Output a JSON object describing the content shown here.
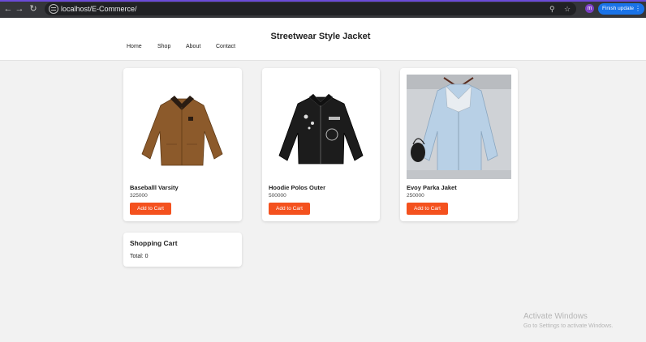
{
  "browser": {
    "url": "localhost/E-Commerce/",
    "profile_initial": "m",
    "finish_update_label": "Finish update",
    "back_icon": "arrow-left-icon",
    "forward_icon": "arrow-right-icon",
    "reload_icon": "reload-icon",
    "accent_color": "#6b4bd8"
  },
  "header": {
    "title": "Streetwear Style Jacket",
    "nav": [
      "Home",
      "Shop",
      "About",
      "Contact"
    ]
  },
  "products": [
    {
      "name": "Baseballl Varsity",
      "price": "325000",
      "button": "Add to Cart"
    },
    {
      "name": "Hoodie Polos Outer",
      "price": "500000",
      "button": "Add to Cart"
    },
    {
      "name": "Evoy Parka Jaket",
      "price": "250000",
      "button": "Add to Cart"
    }
  ],
  "cart": {
    "title": "Shopping Cart",
    "total_label": "Total: 0"
  },
  "watermark": {
    "title": "Activate Windows",
    "subtitle": "Go to Settings to activate Windows."
  },
  "colors": {
    "button": "#f4511e",
    "background": "#f2f2f2"
  }
}
